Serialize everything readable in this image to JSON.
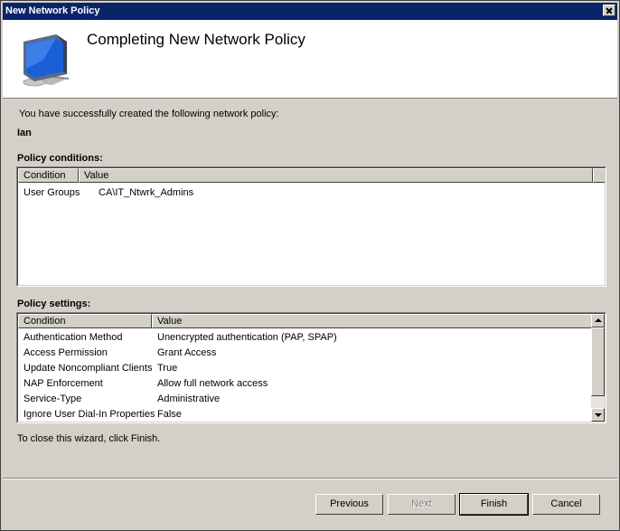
{
  "window": {
    "title": "New Network Policy"
  },
  "header": {
    "title": "Completing New Network Policy"
  },
  "body": {
    "success_message": "You have successfully created the following network policy:",
    "policy_name": "Ian",
    "close_hint": "To close this wizard, click Finish."
  },
  "conditions": {
    "heading": "Policy conditions:",
    "columns": [
      "Condition",
      "Value"
    ],
    "rows": [
      {
        "condition": "User Groups",
        "value": "CA\\IT_Ntwrk_Admins"
      }
    ]
  },
  "settings": {
    "heading": "Policy settings:",
    "columns": [
      "Condition",
      "Value"
    ],
    "rows": [
      {
        "condition": "Authentication Method",
        "value": "Unencrypted authentication (PAP, SPAP)"
      },
      {
        "condition": "Access Permission",
        "value": "Grant Access"
      },
      {
        "condition": "Update Noncompliant Clients",
        "value": "True"
      },
      {
        "condition": "NAP Enforcement",
        "value": "Allow full network access"
      },
      {
        "condition": "Service-Type",
        "value": "Administrative"
      },
      {
        "condition": "Ignore User Dial-In Properties",
        "value": "False"
      }
    ]
  },
  "buttons": {
    "previous": "Previous",
    "next": "Next",
    "finish": "Finish",
    "cancel": "Cancel"
  },
  "icons": {
    "header": "computer-monitor-icon",
    "close": "close-icon"
  },
  "colors": {
    "titlebar": "#0a246a",
    "face": "#d4d0c8"
  }
}
